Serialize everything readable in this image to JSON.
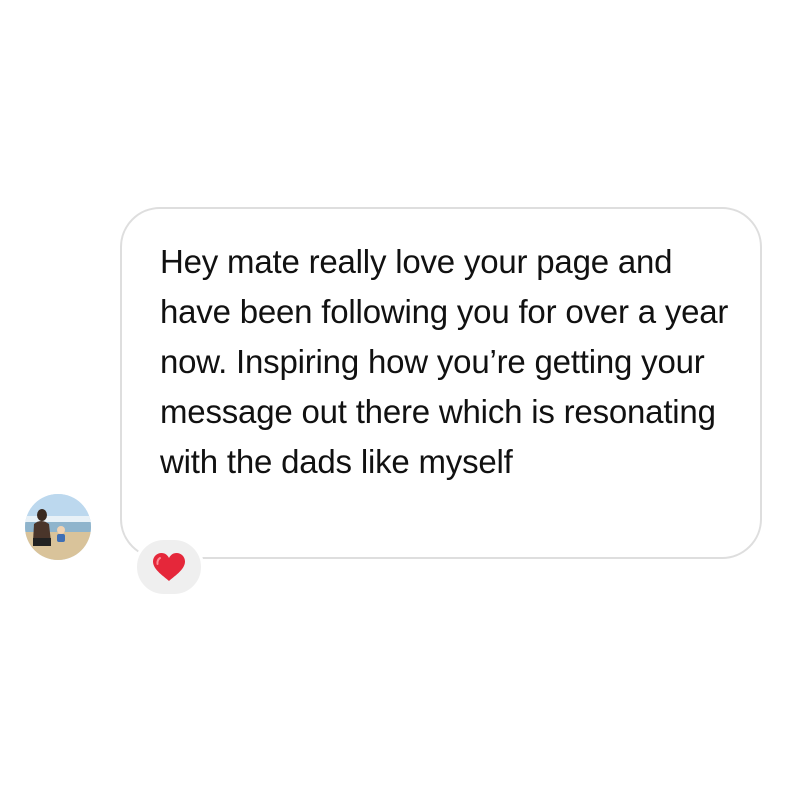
{
  "message": {
    "text": "Hey mate really love your page and have been following you for over a year now. Inspiring how you’re getting your message out there which is resonating with the dads like myself"
  },
  "sender": {
    "avatar_icon": "profile-photo-beach"
  },
  "reaction": {
    "icon": "red-heart-icon",
    "color": "#e5273a"
  },
  "colors": {
    "bubble_border": "#dedede",
    "reaction_background": "#efefef",
    "text": "#111111"
  }
}
